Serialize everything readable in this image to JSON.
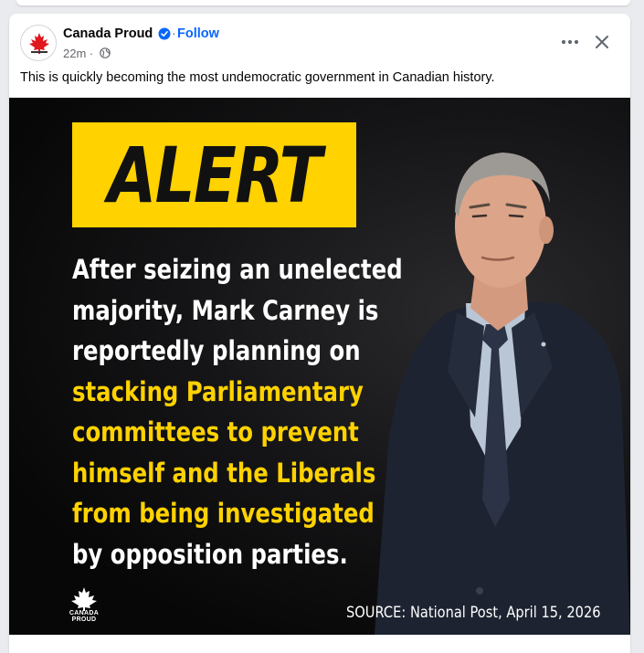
{
  "post": {
    "page_name": "Canada Proud",
    "follow_label": "Follow",
    "separator": "·",
    "timestamp": "22m",
    "meta_dot": "·",
    "caption": "This is quickly becoming the most undemocratic government in Canadian history.",
    "icons": {
      "avatar": "canada-proud-logo",
      "verified": "verified-badge-icon",
      "audience": "globe-icon",
      "more": "more-options-icon",
      "close": "close-icon"
    }
  },
  "image": {
    "alert": "ALERT",
    "headline_white": [
      "After seizing an unelected",
      "majority, Mark Carney is",
      "reportedly planning on"
    ],
    "headline_yellow": [
      "stacking Parliamentary",
      "committees to prevent",
      "himself and the Liberals",
      "from being investigated"
    ],
    "headline_last": "by opposition parties.",
    "logo_text": "CANADA PROUD",
    "source": "SOURCE: National Post, April 15, 2026"
  },
  "colors": {
    "accent_yellow": "#ffd200",
    "link_blue": "#0866ff",
    "canada_red": "#e0181f"
  }
}
